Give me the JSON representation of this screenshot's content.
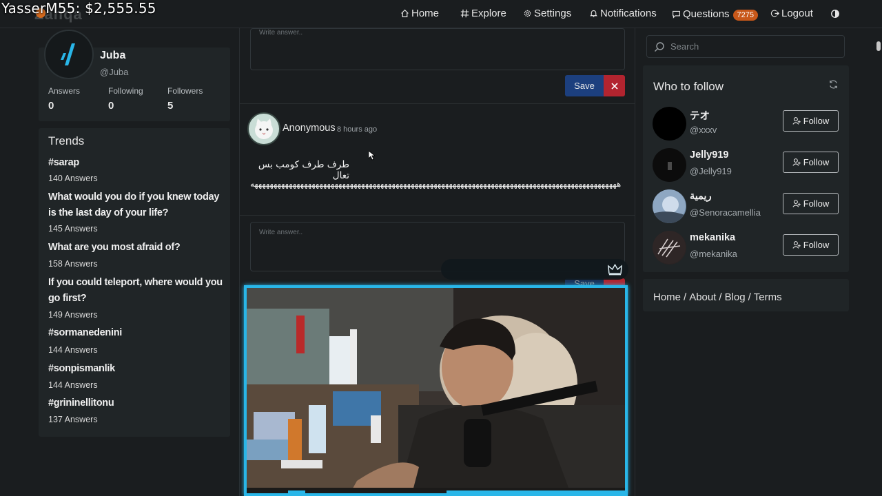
{
  "overlay": {
    "donation_text": "YasserM55: $2,555.55"
  },
  "brand": {
    "logo_text": "Zahqa"
  },
  "nav": {
    "home": "Home",
    "explore": "Explore",
    "settings": "Settings",
    "notifications": "Notifications",
    "questions": "Questions",
    "questions_badge": "7275",
    "logout": "Logout"
  },
  "profile": {
    "name": "Juba",
    "handle": "@Juba",
    "stats": [
      {
        "label": "Answers",
        "value": "0"
      },
      {
        "label": "Following",
        "value": "0"
      },
      {
        "label": "Followers",
        "value": "5"
      }
    ]
  },
  "trends": {
    "title": "Trends",
    "items": [
      {
        "title": "#sarap",
        "count": "140 Answers"
      },
      {
        "title": "What would you do if you knew today is the last day of your life?",
        "count": "145 Answers"
      },
      {
        "title": "What are you most afraid of?",
        "count": "158 Answers"
      },
      {
        "title": "If you could teleport, where would you go first?",
        "count": "149 Answers"
      },
      {
        "title": "#sormanedenini",
        "count": "144 Answers"
      },
      {
        "title": "#sonpismanlik",
        "count": "144 Answers"
      },
      {
        "title": "#grininellitonu",
        "count": "137 Answers"
      }
    ]
  },
  "feed": {
    "answer_placeholder": "Write answer..",
    "save_label": "Save",
    "cancel_label": "✕",
    "post": {
      "author": "Anonymous",
      "time": "8 hours ago",
      "question": "طرف طرف كومب بس تعال",
      "answer": "ههههههههههههههههههههههههههههههههههههههههههههههههههههههههههههههههههههههههههههههههههههههههههههههههه"
    },
    "answer_placeholder_2": "Write answer..",
    "save_label_2": "Save"
  },
  "sidebar": {
    "search_placeholder": "Search",
    "who_to_follow_title": "Who to follow",
    "follow_label": "Follow",
    "users": [
      {
        "name": "テオ",
        "handle": "@xxxv"
      },
      {
        "name": "Jelly919",
        "handle": "@Jelly919"
      },
      {
        "name": "ريمية",
        "handle": "@Senoracamellia"
      },
      {
        "name": "mekanika",
        "handle": "@mekanika"
      }
    ],
    "footer": {
      "home": "Home",
      "about": "About",
      "blog": "Blog",
      "terms": "Terms",
      "sep": "/"
    }
  },
  "colors": {
    "accent_badge": "#c8581a",
    "save_blue": "#1c3f7e",
    "cancel_red": "#b2242f",
    "webcam_border": "#29b6e8"
  }
}
